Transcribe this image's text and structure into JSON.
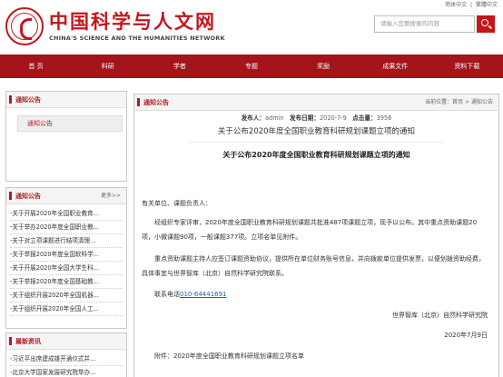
{
  "header": {
    "logo_cn": "中国科学与人文网",
    "logo_en": "CHINA'S SCIENCE AND THE HUMANITIES NETWORK",
    "top_links": [
      "简体中文",
      "|",
      "繁體中文"
    ],
    "search_placeholder": "请输入您要搜索的内容"
  },
  "nav": [
    "首 页",
    "科研",
    "学者",
    "专题",
    "奖励",
    "成果文件",
    "资料下载"
  ],
  "sidebar": {
    "notice": {
      "title": "通知公告",
      "active_item": "通知公告"
    },
    "notice_list": {
      "title": "通知公告",
      "more": "更多>>",
      "items": [
        "-关于开展2020年全国职业教育...",
        "-关于举办2020年度全国职业教...",
        "-关于对立项课题进行结项清理...",
        "-关于举报2020年度全国软科学...",
        "-关于开展2020年全国大学生科...",
        "-关于举报2020年度全国基础教...",
        "-关于组织开展2020年全国机器...",
        "-关于组织开展2020年全国人工..."
      ]
    },
    "news": {
      "title": "最新资讯",
      "items": [
        "-习近平出席建成雄开通仪式并...",
        "-北京大学国家发展研究院举办..."
      ]
    }
  },
  "main": {
    "head_title": "通知公告",
    "location_label": "当前位置：",
    "breadcrumb": "首页 > 通知公告",
    "meta": {
      "author_label": "发布人：",
      "author": "admin",
      "date_label": "发布日期：",
      "date": "2020-7-9",
      "clicks_label": "点击量：",
      "clicks": "3956"
    },
    "title": "关于公布2020年度全国职业教育科研规划课题立项的通知",
    "subtitle": "关于公布2020年度全国职业教育科研规划课题立项的通知",
    "salutation": "有关单位、课题负责人：",
    "para1": "经组织专家评审，2020年度全国职业教育科研规划课题共批准487项课题立项，现予以公布。其中重点资助课题20项，小微课题90项，一般课题377项。立项名单见附件。",
    "para2": "重点资助课题主持人应签订课题资助协议，提供所在单位财务账号信息，并向拨款单位提供发票，以便划拨资助经费，具体事宜与世界智库（北京）自然科学研究院联系。",
    "phone_label": "联系电话",
    "phone": "010-64441691",
    "org": "世界智库（北京）自然科学研究院",
    "date_sign": "2020年7月9日",
    "attachment": "附件：2020年度全国职业教育科研规划课题立项名单"
  }
}
